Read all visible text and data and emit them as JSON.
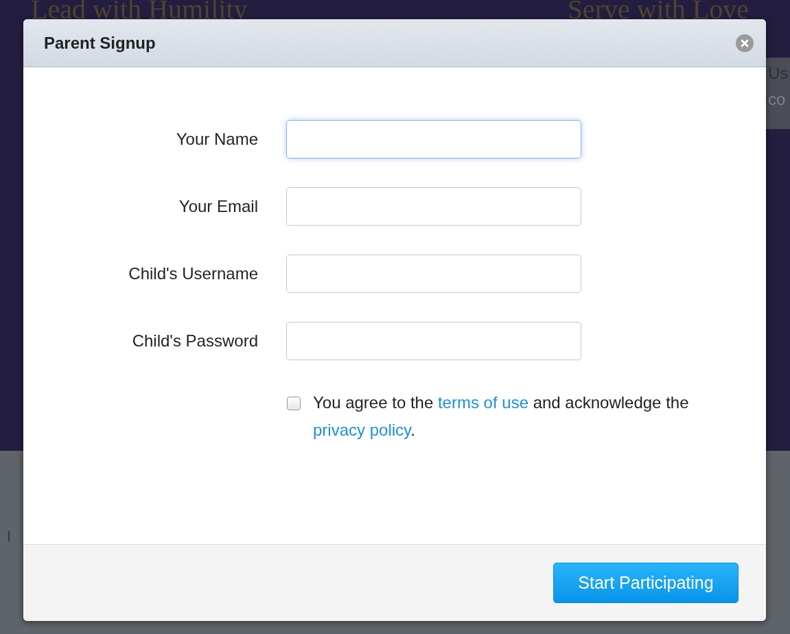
{
  "background": {
    "headings": [
      "Lead with Humility",
      "Serve with Love"
    ],
    "side_text": [
      "Us",
      "co"
    ],
    "lower_text": "I"
  },
  "dialog": {
    "title": "Parent Signup",
    "fields": [
      {
        "label": "Your Name",
        "focused": true
      },
      {
        "label": "Your Email",
        "focused": false
      },
      {
        "label": "Child's Username",
        "focused": false
      },
      {
        "label": "Child's Password",
        "focused": false
      }
    ],
    "agreement": {
      "checked": false,
      "before": "You agree to the ",
      "link1": "terms of use",
      "middle": " and acknowledge the ",
      "link2": "privacy policy",
      "after": "."
    },
    "submit": "Start Participating"
  }
}
